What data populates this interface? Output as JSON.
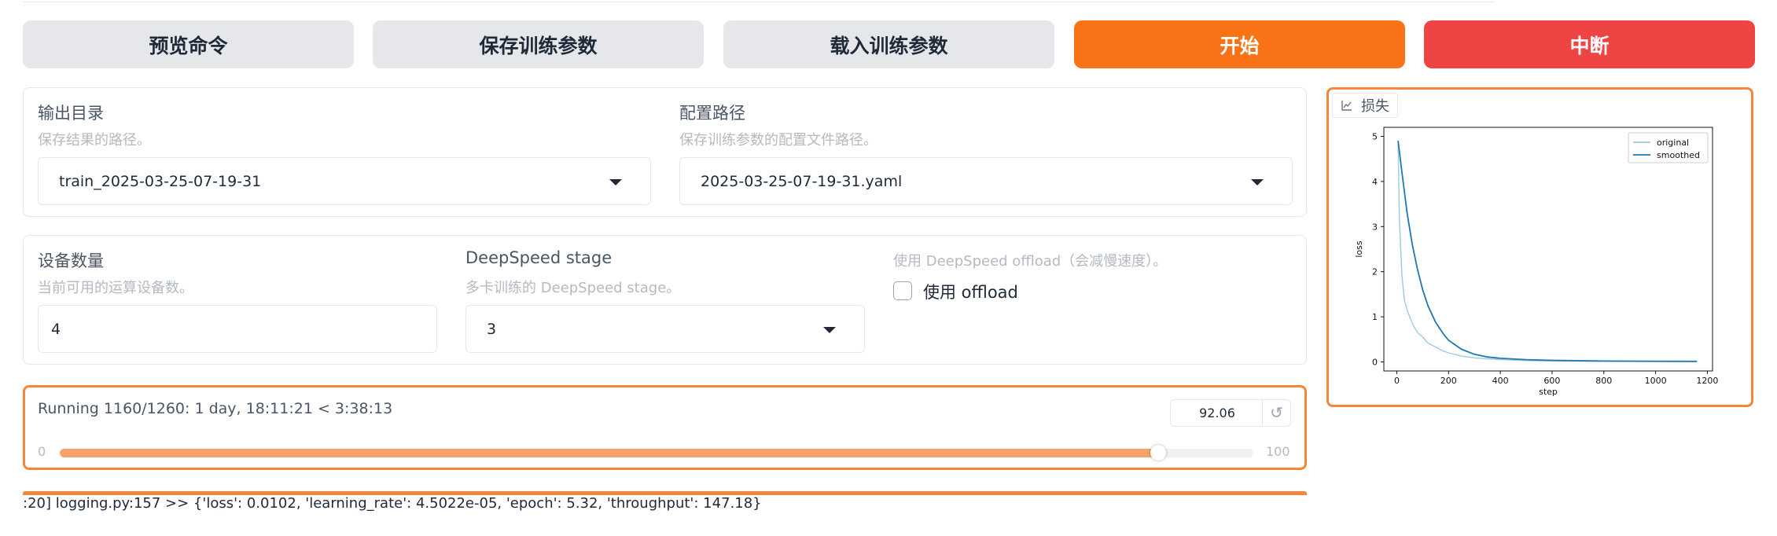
{
  "toolbar": {
    "preview": "预览命令",
    "save": "保存训练参数",
    "load": "载入训练参数",
    "start": "开始",
    "abort": "中断"
  },
  "output": {
    "output_dir_label": "输出目录",
    "output_dir_info": "保存结果的路径。",
    "output_dir_value": "train_2025-03-25-07-19-31",
    "config_path_label": "配置路径",
    "config_path_info": "保存训练参数的配置文件路径。",
    "config_path_value": "2025-03-25-07-19-31.yaml"
  },
  "device": {
    "device_count_label": "设备数量",
    "device_count_info": "当前可用的运算设备数。",
    "device_count_value": "4",
    "ds_stage_label": "DeepSpeed stage",
    "ds_stage_info": "多卡训练的 DeepSpeed stage。",
    "ds_stage_value": "3",
    "ds_offload_info": "使用 DeepSpeed offload（会减慢速度）。",
    "ds_offload_label": "使用 offload",
    "ds_offload_checked": false
  },
  "progress": {
    "status": "Running 1160/1260: 1 day, 18:11:21 < 3:38:13",
    "value": "92.06",
    "percent": 92.06,
    "min_label": "0",
    "max_label": "100",
    "reset_icon": "↺"
  },
  "log": {
    "text": ":20] logging.py:157 >> {'loss': 0.0102, 'learning_rate': 4.5022e-05, 'epoch': 5.32, 'throughput': 147.18}"
  },
  "plot": {
    "tab_label": "损失",
    "tab_icon": "line-chart-icon"
  },
  "chart_data": {
    "type": "line",
    "xlabel": "step",
    "ylabel": "loss",
    "xlim": [
      -50,
      1220
    ],
    "ylim": [
      -0.2,
      5.2
    ],
    "xticks": [
      0,
      200,
      400,
      600,
      800,
      1000,
      1200
    ],
    "yticks": [
      0,
      1,
      2,
      3,
      4,
      5
    ],
    "legend_position": "top-right",
    "series": [
      {
        "name": "original",
        "color": "#9ecae1",
        "x": [
          5,
          10,
          20,
          30,
          40,
          50,
          60,
          80,
          100,
          120,
          150,
          180,
          200,
          250,
          300,
          350,
          400,
          500,
          600,
          800,
          1000,
          1160
        ],
        "y": [
          4.9,
          3.2,
          1.9,
          1.35,
          1.15,
          1.0,
          0.85,
          0.65,
          0.55,
          0.42,
          0.33,
          0.24,
          0.2,
          0.13,
          0.09,
          0.07,
          0.05,
          0.03,
          0.02,
          0.015,
          0.012,
          0.01
        ]
      },
      {
        "name": "smoothed",
        "color": "#1f77b4",
        "x": [
          5,
          20,
          40,
          60,
          80,
          100,
          120,
          150,
          180,
          200,
          250,
          300,
          350,
          400,
          500,
          600,
          800,
          1000,
          1160
        ],
        "y": [
          4.9,
          4.2,
          3.3,
          2.6,
          2.05,
          1.6,
          1.25,
          0.88,
          0.62,
          0.48,
          0.28,
          0.17,
          0.11,
          0.08,
          0.05,
          0.035,
          0.02,
          0.015,
          0.012
        ]
      }
    ]
  }
}
